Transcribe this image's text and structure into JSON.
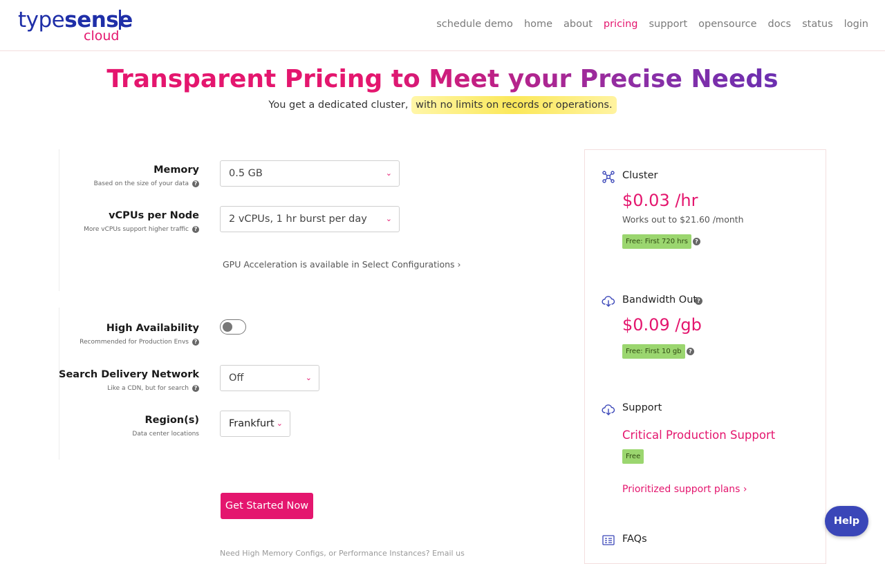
{
  "header": {
    "logo": {
      "type_light": "type",
      "type_bold": "sense",
      "cloud": "cloud"
    },
    "nav": [
      {
        "label": "schedule demo",
        "active": false
      },
      {
        "label": "home",
        "active": false
      },
      {
        "label": "about",
        "active": false
      },
      {
        "label": "pricing",
        "active": true
      },
      {
        "label": "support",
        "active": false
      },
      {
        "label": "opensource",
        "active": false
      },
      {
        "label": "docs",
        "active": false
      },
      {
        "label": "status",
        "active": false
      },
      {
        "label": "login",
        "active": false
      }
    ]
  },
  "hero": {
    "title": "Transparent Pricing to Meet your Precise Needs",
    "subtitle_plain": "You get a dedicated cluster, ",
    "subtitle_highlight": "with no limits on records or operations."
  },
  "config": {
    "memory": {
      "label": "Memory",
      "hint": "Based on the size of your data",
      "value": "0.5 GB"
    },
    "vcpus": {
      "label": "vCPUs per Node",
      "hint": "More vCPUs support higher traffic",
      "value": "2 vCPUs, 1 hr burst per day"
    },
    "gpu_link": "GPU Acceleration is available in Select Configurations ›",
    "high_availability": {
      "label": "High Availability",
      "hint": "Recommended for Production Envs",
      "enabled": false
    },
    "sdn": {
      "label": "Search Delivery Network",
      "hint": "Like a CDN, but for search",
      "value": "Off"
    },
    "regions": {
      "label": "Region(s)",
      "hint": "Data center locations",
      "value": "Frankfurt"
    },
    "cta": "Get Started Now",
    "cut_text": "Need High Memory Configs, or Performance Instances? Email us"
  },
  "summary": {
    "cluster": {
      "title": "Cluster",
      "price": "$0.03 /hr",
      "note": "Works out to $21.60 /month",
      "badge": "Free: First 720 hrs"
    },
    "bandwidth": {
      "title": "Bandwidth Out",
      "price": "$0.09 /gb",
      "badge": "Free: First 10 gb"
    },
    "support": {
      "title": "Support",
      "plan": "Critical Production Support",
      "badge": "Free",
      "link": "Prioritized support plans ›"
    },
    "faqs": {
      "title": "FAQs"
    }
  },
  "help": {
    "label": "Help"
  },
  "colors": {
    "accent": "#e4166e",
    "brand": "#1f2fa8",
    "badge": "#9bd66f",
    "help": "#3a46b8"
  },
  "icons": [
    "chevron-down-icon",
    "question-icon",
    "cluster-icon",
    "cloud-download-icon",
    "faq-icon"
  ]
}
